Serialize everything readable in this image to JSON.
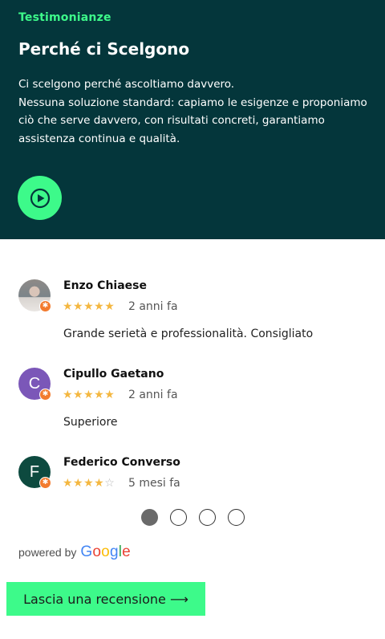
{
  "hero": {
    "eyebrow": "Testimonianze",
    "title": "Perché ci Scelgono",
    "body_lines": [
      "Ci scelgono perché ascoltiamo davvero.",
      "Nessuna soluzione standard: capiamo le esigenze e proponiamo",
      "ciò che serve davvero, con risultati concreti, garantiamo",
      "assistenza continua e qualità."
    ],
    "play_icon": "play-icon"
  },
  "reviews": [
    {
      "name": "Enzo Chiaese",
      "avatar_initial": "",
      "avatar_color": "",
      "rating": 5,
      "time": "2 anni fa",
      "text": "Grande serietà e professionalità. Consigliato"
    },
    {
      "name": "Cipullo Gaetano",
      "avatar_initial": "C",
      "avatar_color": "#7b57b8",
      "rating": 5,
      "time": "2 anni fa",
      "text": "Superiore"
    },
    {
      "name": "Federico Converso",
      "avatar_initial": "F",
      "avatar_color": "#0d4a3f",
      "rating": 4,
      "time": "5 mesi fa",
      "text": ""
    }
  ],
  "carousel": {
    "pages": 4,
    "active": 1
  },
  "powered_by": {
    "label": "powered by",
    "brand": "Google"
  },
  "cta": {
    "label": "Lascia una recensione ⟶"
  },
  "colors": {
    "hero_bg": "#04363b",
    "accent": "#3dfa8a",
    "star": "#f4b740",
    "badge": "#f27b2f"
  }
}
